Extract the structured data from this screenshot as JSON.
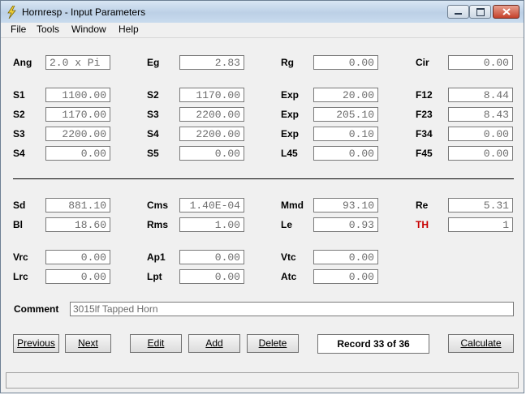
{
  "window": {
    "title": "Hornresp - Input Parameters"
  },
  "menu": [
    "File",
    "Tools",
    "Window",
    "Help"
  ],
  "params": {
    "ang": {
      "label": "Ang",
      "value": "2.0 x Pi"
    },
    "eg": {
      "label": "Eg",
      "value": "2.83"
    },
    "rg": {
      "label": "Rg",
      "value": "0.00"
    },
    "cir": {
      "label": "Cir",
      "value": "0.00"
    },
    "s1": {
      "label": "S1",
      "value": "1100.00"
    },
    "s2a": {
      "label": "S2",
      "value": "1170.00"
    },
    "exp1": {
      "label": "Exp",
      "value": "20.00"
    },
    "f12": {
      "label": "F12",
      "value": "8.44"
    },
    "s2b": {
      "label": "S2",
      "value": "1170.00"
    },
    "s3a": {
      "label": "S3",
      "value": "2200.00"
    },
    "exp2": {
      "label": "Exp",
      "value": "205.10"
    },
    "f23": {
      "label": "F23",
      "value": "8.43"
    },
    "s3b": {
      "label": "S3",
      "value": "2200.00"
    },
    "s4a": {
      "label": "S4",
      "value": "2200.00"
    },
    "exp3": {
      "label": "Exp",
      "value": "0.10"
    },
    "f34": {
      "label": "F34",
      "value": "0.00"
    },
    "s4b": {
      "label": "S4",
      "value": "0.00"
    },
    "s5": {
      "label": "S5",
      "value": "0.00"
    },
    "l45": {
      "label": "L45",
      "value": "0.00"
    },
    "f45": {
      "label": "F45",
      "value": "0.00"
    },
    "sd": {
      "label": "Sd",
      "value": "881.10"
    },
    "cms": {
      "label": "Cms",
      "value": "1.40E-04"
    },
    "mmd": {
      "label": "Mmd",
      "value": "93.10"
    },
    "re": {
      "label": "Re",
      "value": "5.31"
    },
    "bl": {
      "label": "Bl",
      "value": "18.60"
    },
    "rms": {
      "label": "Rms",
      "value": "1.00"
    },
    "le": {
      "label": "Le",
      "value": "0.93"
    },
    "th": {
      "label": "TH",
      "value": "1"
    },
    "vrc": {
      "label": "Vrc",
      "value": "0.00"
    },
    "ap1": {
      "label": "Ap1",
      "value": "0.00"
    },
    "vtc": {
      "label": "Vtc",
      "value": "0.00"
    },
    "lrc": {
      "label": "Lrc",
      "value": "0.00"
    },
    "lpt": {
      "label": "Lpt",
      "value": "0.00"
    },
    "atc": {
      "label": "Atc",
      "value": "0.00"
    }
  },
  "comment": {
    "label": "Comment",
    "value": "3015lf Tapped Horn"
  },
  "buttons": {
    "previous": "Previous",
    "next": "Next",
    "edit": "Edit",
    "add": "Add",
    "delete": "Delete",
    "calculate": "Calculate"
  },
  "record": "Record 33 of 36",
  "colors": {
    "th_label": "#c80000"
  }
}
